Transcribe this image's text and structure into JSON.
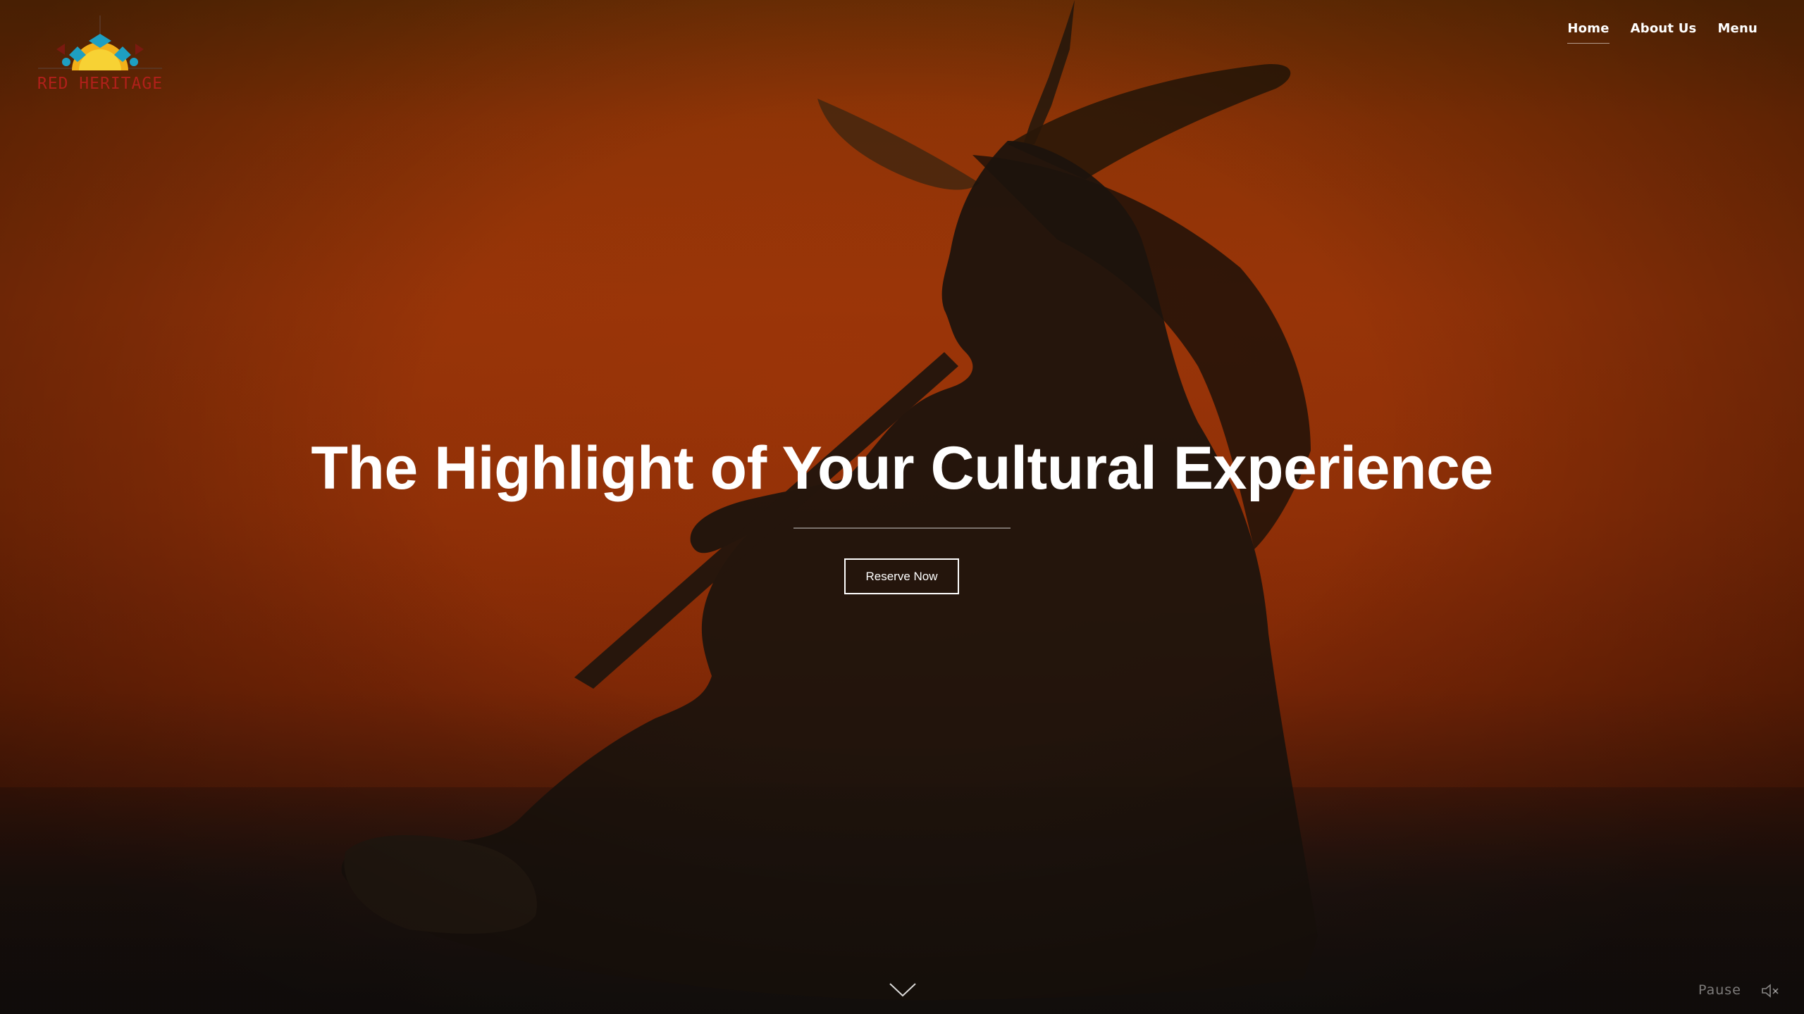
{
  "brand": {
    "logo_text": "RED HERITAGE"
  },
  "nav": {
    "items": [
      {
        "label": "Home",
        "active": true
      },
      {
        "label": "About Us"
      },
      {
        "label": "Menu"
      }
    ]
  },
  "hero": {
    "headline": "The Highlight of Your Cultural Experience",
    "cta_label": "Reserve Now",
    "background_description": "silhouette of a seated man in a feathered headdress playing a flute against an orange backdrop",
    "background_color": "#8e3207"
  },
  "media_controls": {
    "pause_label": "Pause",
    "mute_icon": "speaker-muted-icon"
  },
  "icons": {
    "scroll": "chevron-down-icon"
  }
}
